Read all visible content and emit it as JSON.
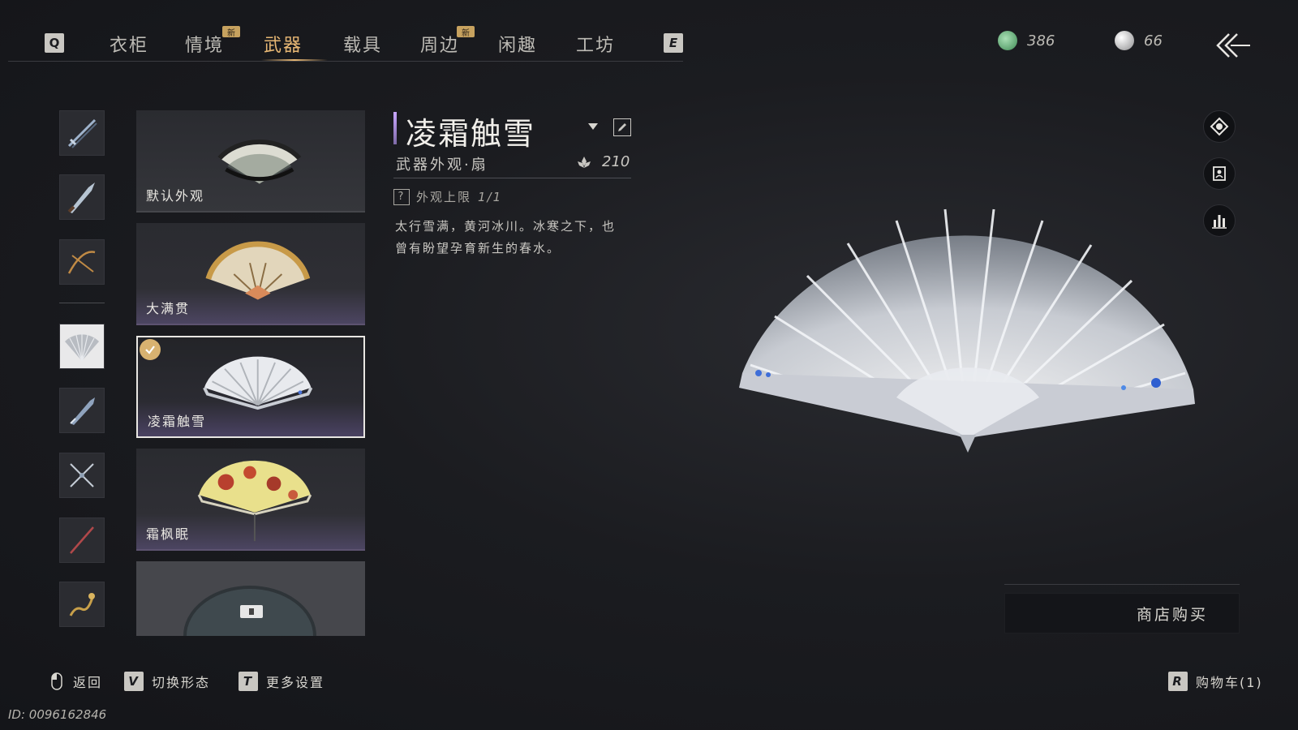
{
  "nav": {
    "prev_key": "Q",
    "next_key": "E",
    "tabs": [
      {
        "label": "衣柜",
        "badge": ""
      },
      {
        "label": "情境",
        "badge": "新"
      },
      {
        "label": "武器",
        "badge": ""
      },
      {
        "label": "载具",
        "badge": ""
      },
      {
        "label": "周边",
        "badge": "新"
      },
      {
        "label": "闲趣",
        "badge": ""
      },
      {
        "label": "工坊",
        "badge": ""
      }
    ],
    "active_tab": "武器"
  },
  "currency": {
    "jade": "386",
    "pearl": "66"
  },
  "categories": [
    {
      "icon": "sword-icon"
    },
    {
      "icon": "blade-icon"
    },
    {
      "icon": "spear-icon"
    },
    {
      "icon": "fan-icon",
      "active": true
    },
    {
      "icon": "umbrella-icon"
    },
    {
      "icon": "dual-blades-icon"
    },
    {
      "icon": "staff-icon"
    },
    {
      "icon": "rope-dart-icon"
    }
  ],
  "cards": [
    {
      "label": "默认外观"
    },
    {
      "label": "大满贯"
    },
    {
      "label": "凌霜触雪",
      "selected": true
    },
    {
      "label": "霜枫眠"
    },
    {
      "label": ""
    }
  ],
  "detail": {
    "title": "凌霜触雪",
    "subtitle": "武器外观·扇",
    "score": "210",
    "limit_prefix": "外观上限",
    "limit_value": "1/1",
    "help_key": "?",
    "description_line1": "太行雪满，黄河冰川。冰寒之下，也",
    "description_line2": "曾有盼望孕育新生的春水。"
  },
  "buy": {
    "label": "商店购买"
  },
  "bottom": {
    "back_label": "返回",
    "switch_key": "V",
    "switch_label": "切换形态",
    "more_key": "T",
    "more_label": "更多设置",
    "cart_key": "R",
    "cart_label": "购物车(1)",
    "id_text": "ID: 0096162846"
  },
  "colors": {
    "accent": "#e7b774",
    "background": "#1b1c20",
    "title_bar": "#b89bf0"
  }
}
